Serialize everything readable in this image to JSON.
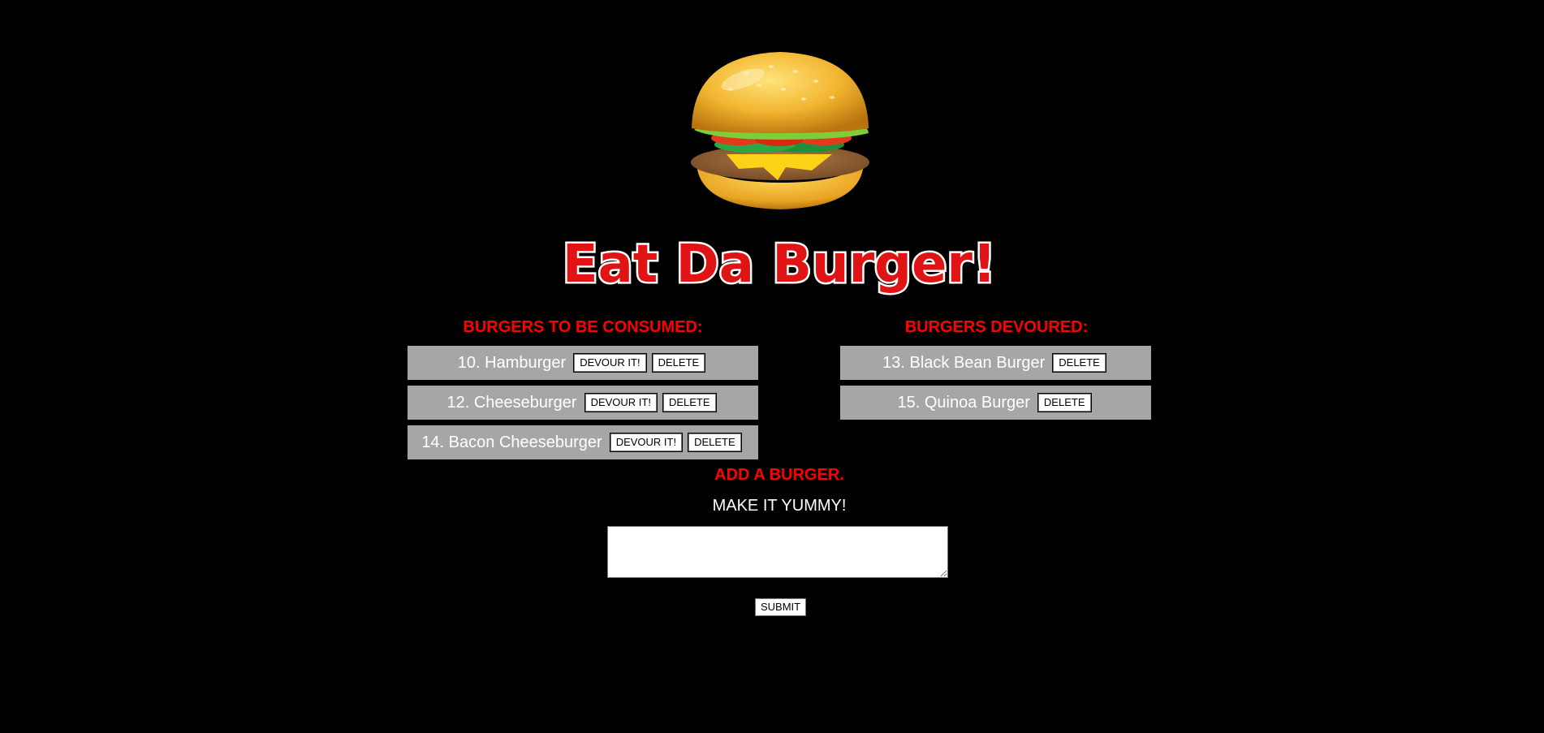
{
  "logo": {
    "title_text": "Eat Da Burger!"
  },
  "to_consume": {
    "heading": "BURGERS TO BE CONSUMED:",
    "items": [
      {
        "label": "10. Hamburger",
        "devour_label": "DEVOUR IT!",
        "delete_label": "DELETE"
      },
      {
        "label": "12. Cheeseburger",
        "devour_label": "DEVOUR IT!",
        "delete_label": "DELETE"
      },
      {
        "label": "14. Bacon Cheeseburger",
        "devour_label": "DEVOUR IT!",
        "delete_label": "DELETE"
      }
    ]
  },
  "devoured": {
    "heading": "BURGERS DEVOURED:",
    "items": [
      {
        "label": "13. Black Bean Burger",
        "delete_label": "DELETE"
      },
      {
        "label": "15. Quinoa Burger",
        "delete_label": "DELETE"
      }
    ]
  },
  "add_form": {
    "heading": "ADD A BURGER.",
    "prompt": "MAKE IT YUMMY!",
    "input_value": "",
    "submit_label": "SUBMIT"
  },
  "colors": {
    "background": "#000000",
    "heading": "#ff0000",
    "row": "#a6a6a6",
    "text": "#ffffff"
  }
}
